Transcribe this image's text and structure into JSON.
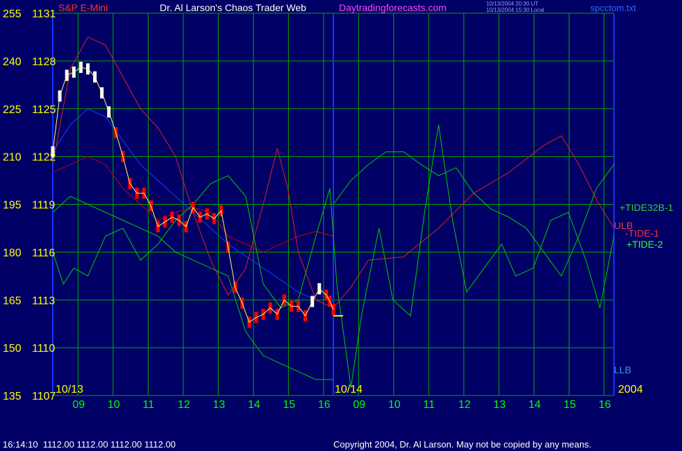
{
  "header": {
    "symbol": "S&P E-Mini",
    "title": "Dr. Al Larson's Chaos Trader Web",
    "site": "Daytradingforecasts.com",
    "timestamp_ut": "10/13/2004 20:30 UT",
    "timestamp_local": "10/13/2004 15:30 Local",
    "filename": "spcctom.txt"
  },
  "footer": {
    "status": "16:14:10  1112.00 1112.00 1112.00 1112.00",
    "copyright": "Copyright 2004, Dr. Al Larson. May not be copied by any means."
  },
  "colors": {
    "background": "#000066",
    "grid": "#00aa00",
    "price_bar": "#ff0000",
    "price_fast_bar": "#ffffff",
    "ulb_line": "#cc0000",
    "llb_line": "#00cc00",
    "tide1": "#dd2222",
    "tide2": "#00cc00",
    "tide32b": "#1144ff",
    "yellow_text": "#ffff00",
    "time_label": "#00ff00"
  },
  "chart_data": {
    "type": "line",
    "left_axis_index": [
      "255",
      "240",
      "225",
      "210",
      "195",
      "180",
      "165",
      "150",
      "135"
    ],
    "left_axis_price": [
      "1131",
      "1128",
      "1125",
      "1122",
      "1119",
      "1116",
      "1113",
      "1110",
      "1107"
    ],
    "ylim": [
      1107,
      1131
    ],
    "x_time_labels": [
      "09",
      "10",
      "11",
      "12",
      "13",
      "14",
      "15",
      "16",
      "09",
      "10",
      "11",
      "12",
      "13",
      "14",
      "15",
      "16"
    ],
    "date_labels": [
      "10/13",
      "10/14",
      "2004"
    ],
    "series_labels": [
      "+TIDE32B-1",
      "ULB",
      "-TIDE-1",
      "+TIDE-2",
      "LLB"
    ],
    "price": [
      [
        0.0,
        1122.3
      ],
      [
        0.2,
        1125.8
      ],
      [
        0.4,
        1127.1
      ],
      [
        0.6,
        1127.3
      ],
      [
        0.8,
        1127.6
      ],
      [
        1.0,
        1127.5
      ],
      [
        1.2,
        1127.0
      ],
      [
        1.4,
        1126.0
      ],
      [
        1.6,
        1124.8
      ],
      [
        1.8,
        1123.5
      ],
      [
        2.0,
        1122.0
      ],
      [
        2.2,
        1120.3
      ],
      [
        2.4,
        1119.7
      ],
      [
        2.6,
        1119.7
      ],
      [
        2.8,
        1118.9
      ],
      [
        3.0,
        1117.6
      ],
      [
        3.2,
        1117.9
      ],
      [
        3.4,
        1118.2
      ],
      [
        3.6,
        1118.0
      ],
      [
        3.8,
        1117.6
      ],
      [
        4.0,
        1118.8
      ],
      [
        4.2,
        1118.2
      ],
      [
        4.4,
        1118.4
      ],
      [
        4.6,
        1118.1
      ],
      [
        4.8,
        1118.6
      ],
      [
        5.0,
        1116.3
      ],
      [
        5.2,
        1113.8
      ],
      [
        5.4,
        1112.8
      ],
      [
        5.6,
        1111.6
      ],
      [
        5.8,
        1111.9
      ],
      [
        6.0,
        1112.1
      ],
      [
        6.2,
        1112.5
      ],
      [
        6.4,
        1112.1
      ],
      [
        6.6,
        1113.0
      ],
      [
        6.8,
        1112.6
      ],
      [
        7.0,
        1112.6
      ],
      [
        7.2,
        1112.0
      ],
      [
        7.4,
        1112.9
      ],
      [
        7.6,
        1113.7
      ],
      [
        7.8,
        1113.3
      ],
      [
        7.9,
        1112.9
      ],
      [
        8.0,
        1112.4
      ]
    ],
    "price_close_mark": 1112.0,
    "tide1": [
      [
        0.0,
        1121.5
      ],
      [
        0.5,
        1127.5
      ],
      [
        1.0,
        1129.5
      ],
      [
        1.5,
        1129.0
      ],
      [
        2.0,
        1127.0
      ],
      [
        2.5,
        1125.0
      ],
      [
        3.0,
        1123.8
      ],
      [
        3.5,
        1122.0
      ],
      [
        4.0,
        1118.5
      ],
      [
        4.5,
        1115.5
      ],
      [
        5.0,
        1113.3
      ],
      [
        5.5,
        1115.0
      ],
      [
        6.0,
        1119.0
      ],
      [
        6.4,
        1122.5
      ],
      [
        6.7,
        1120.0
      ],
      [
        7.0,
        1116.0
      ],
      [
        7.5,
        1113.0
      ],
      [
        8.0,
        1112.5
      ],
      [
        8.5,
        1113.8
      ],
      [
        9.0,
        1115.5
      ],
      [
        10.0,
        1115.7
      ],
      [
        11.0,
        1117.5
      ],
      [
        12.0,
        1119.7
      ],
      [
        13.0,
        1121.0
      ],
      [
        14.0,
        1122.7
      ],
      [
        14.5,
        1123.3
      ],
      [
        15.0,
        1121.5
      ],
      [
        15.5,
        1119.3
      ],
      [
        16.0,
        1117.5
      ]
    ],
    "tide2": [
      [
        0.0,
        1116.0
      ],
      [
        0.3,
        1114.0
      ],
      [
        0.6,
        1115.0
      ],
      [
        1.0,
        1114.5
      ],
      [
        1.5,
        1117.0
      ],
      [
        2.0,
        1117.5
      ],
      [
        2.5,
        1115.5
      ],
      [
        3.0,
        1116.5
      ],
      [
        3.5,
        1118.0
      ],
      [
        4.0,
        1119.0
      ],
      [
        4.5,
        1120.3
      ],
      [
        5.0,
        1120.8
      ],
      [
        5.5,
        1119.5
      ],
      [
        6.0,
        1114.0
      ],
      [
        6.5,
        1112.5
      ],
      [
        7.0,
        1113.0
      ],
      [
        7.5,
        1117.0
      ],
      [
        7.9,
        1120.0
      ],
      [
        8.1,
        1114.0
      ],
      [
        8.5,
        1107.5
      ],
      [
        8.8,
        1112.0
      ],
      [
        9.3,
        1117.5
      ],
      [
        9.7,
        1113.0
      ],
      [
        10.2,
        1112.0
      ],
      [
        10.6,
        1118.5
      ],
      [
        11.0,
        1124.0
      ],
      [
        11.4,
        1118.0
      ],
      [
        11.8,
        1113.5
      ],
      [
        12.3,
        1115.0
      ],
      [
        12.8,
        1116.5
      ],
      [
        13.2,
        1114.5
      ],
      [
        13.7,
        1115.0
      ],
      [
        14.2,
        1118.0
      ],
      [
        14.7,
        1118.5
      ],
      [
        15.2,
        1115.5
      ],
      [
        15.6,
        1112.5
      ],
      [
        16.0,
        1117.0
      ]
    ],
    "tide32b": [
      [
        0.0,
        1122.3
      ],
      [
        0.5,
        1124.0
      ],
      [
        1.0,
        1125.0
      ],
      [
        1.5,
        1124.5
      ],
      [
        2.0,
        1123.0
      ],
      [
        2.5,
        1121.5
      ],
      [
        3.0,
        1120.5
      ],
      [
        3.5,
        1119.5
      ],
      [
        4.0,
        1118.5
      ],
      [
        5.0,
        1116.5
      ],
      [
        6.0,
        1115.0
      ],
      [
        7.0,
        1113.5
      ],
      [
        8.0,
        1112.5
      ]
    ],
    "ulb": [
      [
        0.0,
        1121.0
      ],
      [
        0.5,
        1121.5
      ],
      [
        1.0,
        1122.0
      ],
      [
        1.5,
        1121.5
      ],
      [
        2.0,
        1120.0
      ],
      [
        2.5,
        1119.0
      ],
      [
        3.0,
        1118.0
      ],
      [
        3.5,
        1118.5
      ],
      [
        4.0,
        1118.8
      ],
      [
        4.5,
        1118.5
      ],
      [
        5.0,
        1117.0
      ],
      [
        5.5,
        1116.5
      ],
      [
        6.0,
        1116.0
      ],
      [
        6.5,
        1116.5
      ],
      [
        7.0,
        1117.0
      ],
      [
        7.5,
        1117.3
      ],
      [
        8.0,
        1117.0
      ]
    ],
    "llb": [
      [
        0.0,
        1118.5
      ],
      [
        0.5,
        1119.5
      ],
      [
        1.0,
        1119.0
      ],
      [
        1.5,
        1118.5
      ],
      [
        2.0,
        1118.0
      ],
      [
        2.5,
        1117.5
      ],
      [
        3.0,
        1117.0
      ],
      [
        3.5,
        1116.0
      ],
      [
        4.0,
        1115.5
      ],
      [
        4.5,
        1115.0
      ],
      [
        5.0,
        1114.5
      ],
      [
        5.5,
        1111.0
      ],
      [
        6.0,
        1109.5
      ],
      [
        6.5,
        1109.0
      ],
      [
        7.0,
        1108.5
      ],
      [
        7.5,
        1108.0
      ],
      [
        8.0,
        1108.0
      ]
    ],
    "tide2_right": [
      [
        8.0,
        1119.0
      ],
      [
        8.5,
        1120.5
      ],
      [
        9.0,
        1121.5
      ],
      [
        9.5,
        1122.3
      ],
      [
        10.0,
        1122.3
      ],
      [
        10.5,
        1121.5
      ],
      [
        11.0,
        1120.8
      ],
      [
        11.5,
        1121.3
      ],
      [
        12.0,
        1119.7
      ],
      [
        12.5,
        1118.7
      ],
      [
        13.0,
        1118.2
      ],
      [
        13.5,
        1117.5
      ],
      [
        14.0,
        1116.0
      ],
      [
        14.5,
        1114.5
      ],
      [
        15.0,
        1117.0
      ],
      [
        15.5,
        1120.0
      ],
      [
        16.0,
        1121.5
      ]
    ],
    "grid": true
  }
}
